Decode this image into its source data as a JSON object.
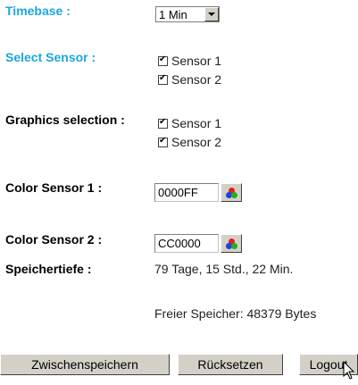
{
  "timebase": {
    "label": "Timebase :",
    "value": "1 Min"
  },
  "select_sensor": {
    "label": "Select Sensor :",
    "options": [
      "Sensor 1",
      "Sensor 2"
    ]
  },
  "graphics_selection": {
    "label": "Graphics selection :",
    "options": [
      "Sensor 1",
      "Sensor 2"
    ]
  },
  "color_sensor_1": {
    "label": "Color Sensor 1 :",
    "value": "0000FF"
  },
  "color_sensor_2": {
    "label": "Color Sensor 2 :",
    "value": "CC0000"
  },
  "speichertiefe": {
    "label": "Speichertiefe :",
    "value": "79 Tage, 15 Std., 22 Min."
  },
  "freier_speicher": "Freier Speicher: 48379 Bytes",
  "buttons": {
    "save": "Zwischenspeichern",
    "reset": "Rücksetzen",
    "logout": "Logout"
  },
  "colors": {
    "label_blue": "#1ba6e0",
    "button_face": "#d4d0c8"
  }
}
